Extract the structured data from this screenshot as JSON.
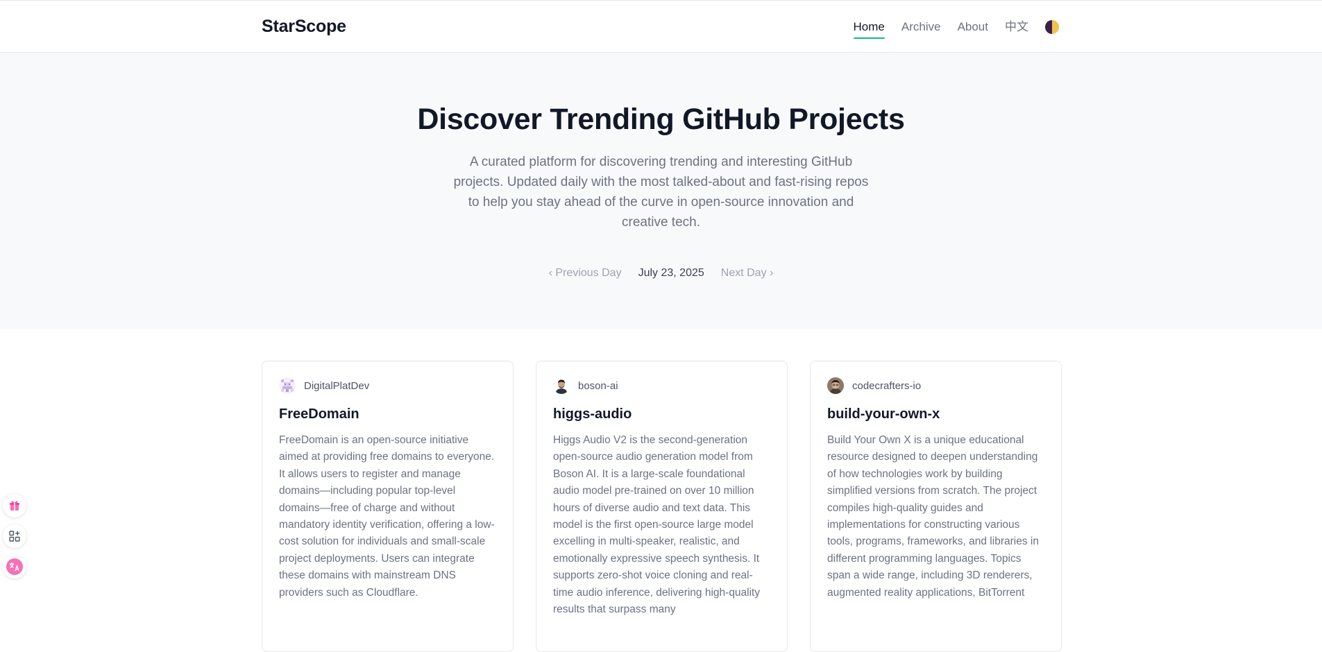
{
  "brand": "StarScope",
  "nav": {
    "home": "Home",
    "archive": "Archive",
    "about": "About",
    "lang": "中文"
  },
  "hero": {
    "title": "Discover Trending GitHub Projects",
    "subtitle": "A curated platform for discovering trending and interesting GitHub projects. Updated daily with the most talked-about and fast-rising repos to help you stay ahead of the curve in open-source innovation and creative tech.",
    "prev_day": "‹ Previous Day",
    "current_date": "July 23, 2025",
    "next_day": "Next Day ›"
  },
  "cards": [
    {
      "owner": "DigitalPlatDev",
      "name": "FreeDomain",
      "description": "FreeDomain is an open-source initiative aimed at providing free domains to everyone. It allows users to register and manage domains—including popular top-level domains—free of charge and without mandatory identity verification, offering a low-cost solution for individuals and small-scale project deployments. Users can integrate these domains with mainstream DNS providers such as Cloudflare.",
      "avatar_icon": "pixel-avatar-icon"
    },
    {
      "owner": "boson-ai",
      "name": "higgs-audio",
      "description": "Higgs Audio V2 is the second-generation open-source audio generation model from Boson AI. It is a large-scale foundational audio model pre-trained on over 10 million hours of diverse audio and text data. This model is the first open-source large model excelling in multi-speaker, realistic, and emotionally expressive speech synthesis. It supports zero-shot voice cloning and real-time audio inference, delivering high-quality results that surpass many",
      "avatar_icon": "person-avatar-icon"
    },
    {
      "owner": "codecrafters-io",
      "name": "build-your-own-x",
      "description": "Build Your Own X is a unique educational resource designed to deepen understanding of how technologies work by building simplified versions from scratch. The project compiles high-quality guides and implementations for constructing various tools, programs, frameworks, and libraries in different programming languages. Topics span a wide range, including 3D renderers, augmented reality applications, BitTorrent",
      "avatar_icon": "person-avatar-icon"
    }
  ],
  "side_tools": [
    "gift-icon",
    "apps-icon",
    "translate-icon"
  ],
  "colors": {
    "accent": "#10b981",
    "hero_bg": "#f8f9fb",
    "text_primary": "#111827",
    "text_muted": "#6b7280"
  }
}
